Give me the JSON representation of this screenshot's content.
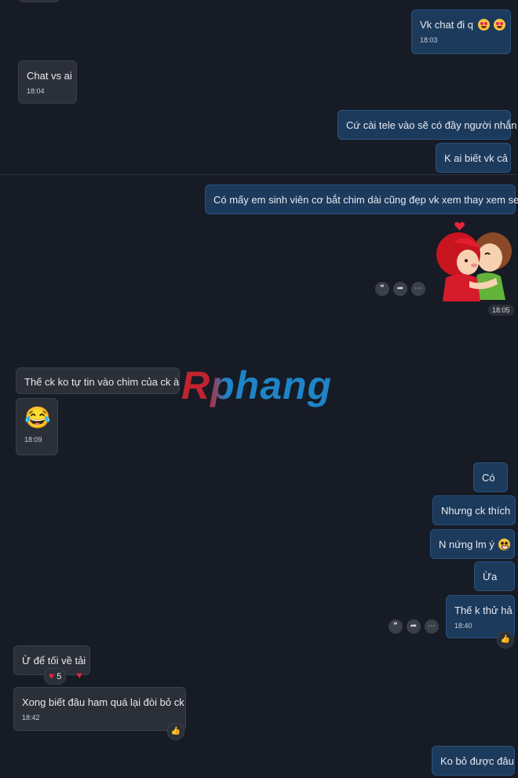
{
  "messages": {
    "m1": {
      "text": "Vk chat đi q",
      "time": "18:03"
    },
    "m2": {
      "text": "Chat vs ai",
      "time": "18:04"
    },
    "m3": {
      "text": "Cứ cài tele vào sẽ có đầy người nhắn"
    },
    "m4": {
      "text": "K ai biết vk cả"
    },
    "m5": {
      "text": "Có mấy em sinh viên cơ bắt chim dài cũng đẹp vk xem thay xem sex"
    },
    "sticker": {
      "time": "18:05"
    },
    "m6": {
      "text": "Thế ck ko tự tin vào chim của ck à"
    },
    "m7": {
      "emoji": "😂",
      "time": "18:09"
    },
    "m8": {
      "text": "Có"
    },
    "m9": {
      "text": "Nhưng ck thích"
    },
    "m10": {
      "text": "N nứng lm ý"
    },
    "m11": {
      "text": "Ừa"
    },
    "m12": {
      "text": "Thế k thử hả",
      "time": "18:40"
    },
    "m13": {
      "text": "Ừ để tối về tải",
      "reaction_count": "5"
    },
    "m14": {
      "text": "Xong biết đâu ham quá lại đòi bỏ ck",
      "time": "18:42"
    },
    "m15": {
      "text": "Ko bỏ được đâu"
    }
  },
  "watermark": {
    "text": "Rphang"
  },
  "colors": {
    "background": "#161b25",
    "incoming": "#2b2f38",
    "outgoing": "#1c3a5c",
    "watermark_red": "#c0242f",
    "watermark_blue": "#1f84c7"
  },
  "icons": [
    "quote-icon",
    "forward-icon",
    "more-icon",
    "like-icon",
    "heart-icon",
    "smile-icon"
  ]
}
